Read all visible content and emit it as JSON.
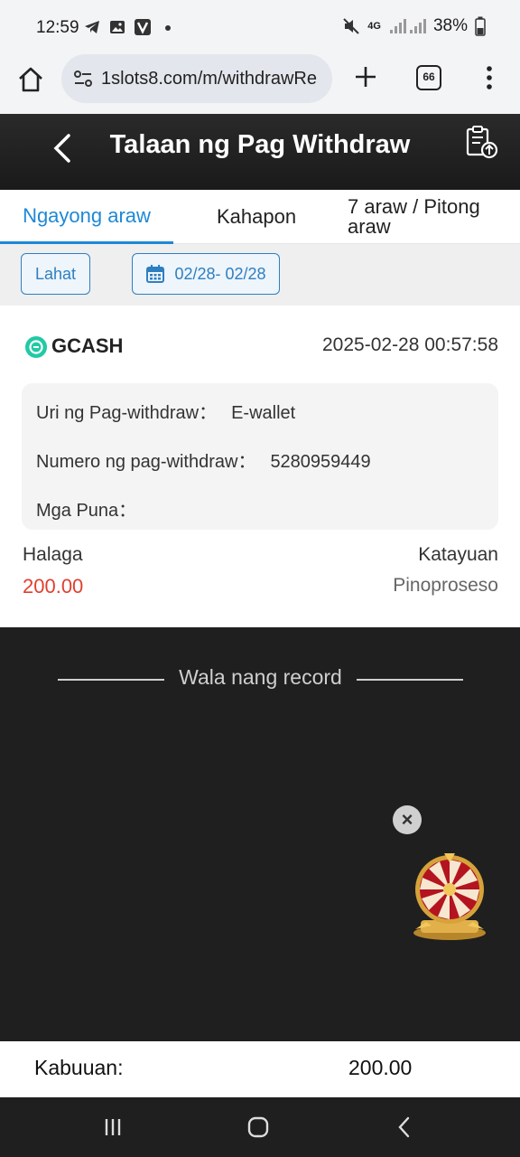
{
  "status_bar": {
    "time": "12:59",
    "network": "4G",
    "battery": "38%",
    "icons": [
      "telegram-icon",
      "gallery-icon",
      "v-app-icon",
      "dot-icon",
      "mute-icon",
      "signal-icon",
      "battery-icon"
    ]
  },
  "browser": {
    "url": "1slots8.com/m/withdrawRe",
    "tab_count": "66"
  },
  "header": {
    "title": "Talaan ng Pag Withdraw"
  },
  "tabs": [
    {
      "label": "Ngayong araw",
      "active": true
    },
    {
      "label": "Kahapon",
      "active": false
    },
    {
      "label": "7 araw / Pitong araw",
      "active": false
    }
  ],
  "filters": {
    "all_label": "Lahat",
    "date_range": "02/28- 02/28"
  },
  "record": {
    "method": "GCASH",
    "datetime": "2025-02-28 00:57:58",
    "type_label": "Uri ng Pag-withdraw：",
    "type_value": "E-wallet",
    "number_label": "Numero ng pag-withdraw：",
    "number_value": "5280959449",
    "remarks_label": "Mga Puna：",
    "remarks_value": "",
    "amount_label": "Halaga",
    "amount_value": "200.00",
    "status_label": "Katayuan",
    "status_value": "Pinoproseso"
  },
  "no_more_text": "Wala nang record",
  "total": {
    "label": "Kabuuan:",
    "value": "200.00"
  },
  "colors": {
    "accent": "#1e88d6",
    "amount": "#e0402f",
    "header_bg": "#1f1f1f"
  }
}
